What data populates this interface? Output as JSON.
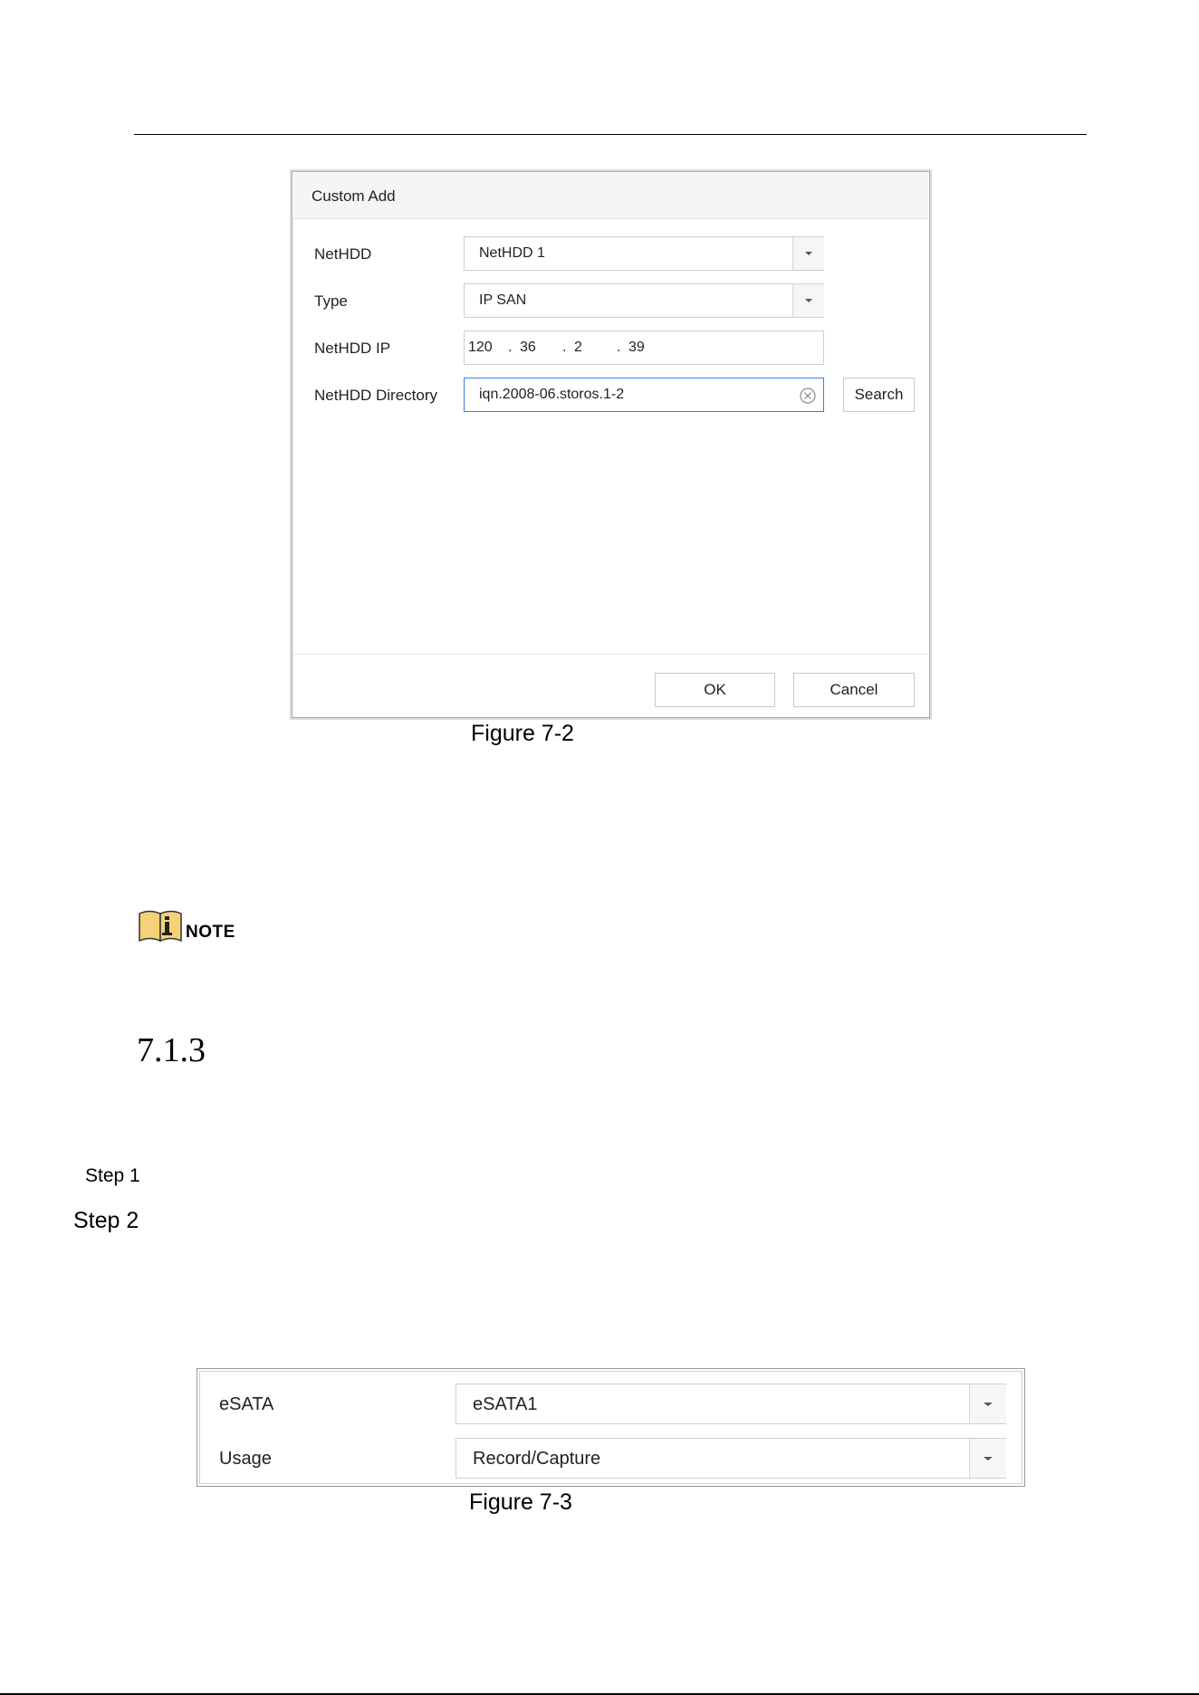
{
  "dialog": {
    "title": "Custom Add",
    "nethdd": {
      "label": "NetHDD",
      "value": "NetHDD 1"
    },
    "type": {
      "label": "Type",
      "value": "IP SAN"
    },
    "nethdd_ip": {
      "label": "NetHDD IP",
      "octets": [
        "120",
        "36",
        "2",
        "39"
      ],
      "dot": "."
    },
    "directory": {
      "label": "NetHDD Directory",
      "value": "iqn.2008-06.storos.1-2"
    },
    "search_label": "Search",
    "ok_label": "OK",
    "cancel_label": "Cancel"
  },
  "figure1_caption": "Figure 7-2",
  "note": {
    "label": "NOTE",
    "icon": "note-book-icon"
  },
  "section_number": "7.1.3",
  "steps": [
    "Step 1",
    "Step 2"
  ],
  "esata_panel": {
    "esata": {
      "label": "eSATA",
      "value": "eSATA1"
    },
    "usage": {
      "label": "Usage",
      "value": "Record/Capture"
    }
  },
  "figure2_caption": "Figure 7-3",
  "colors": {
    "focus_border": "#3d7fd6",
    "note_icon_fill": "#f5d27a"
  }
}
